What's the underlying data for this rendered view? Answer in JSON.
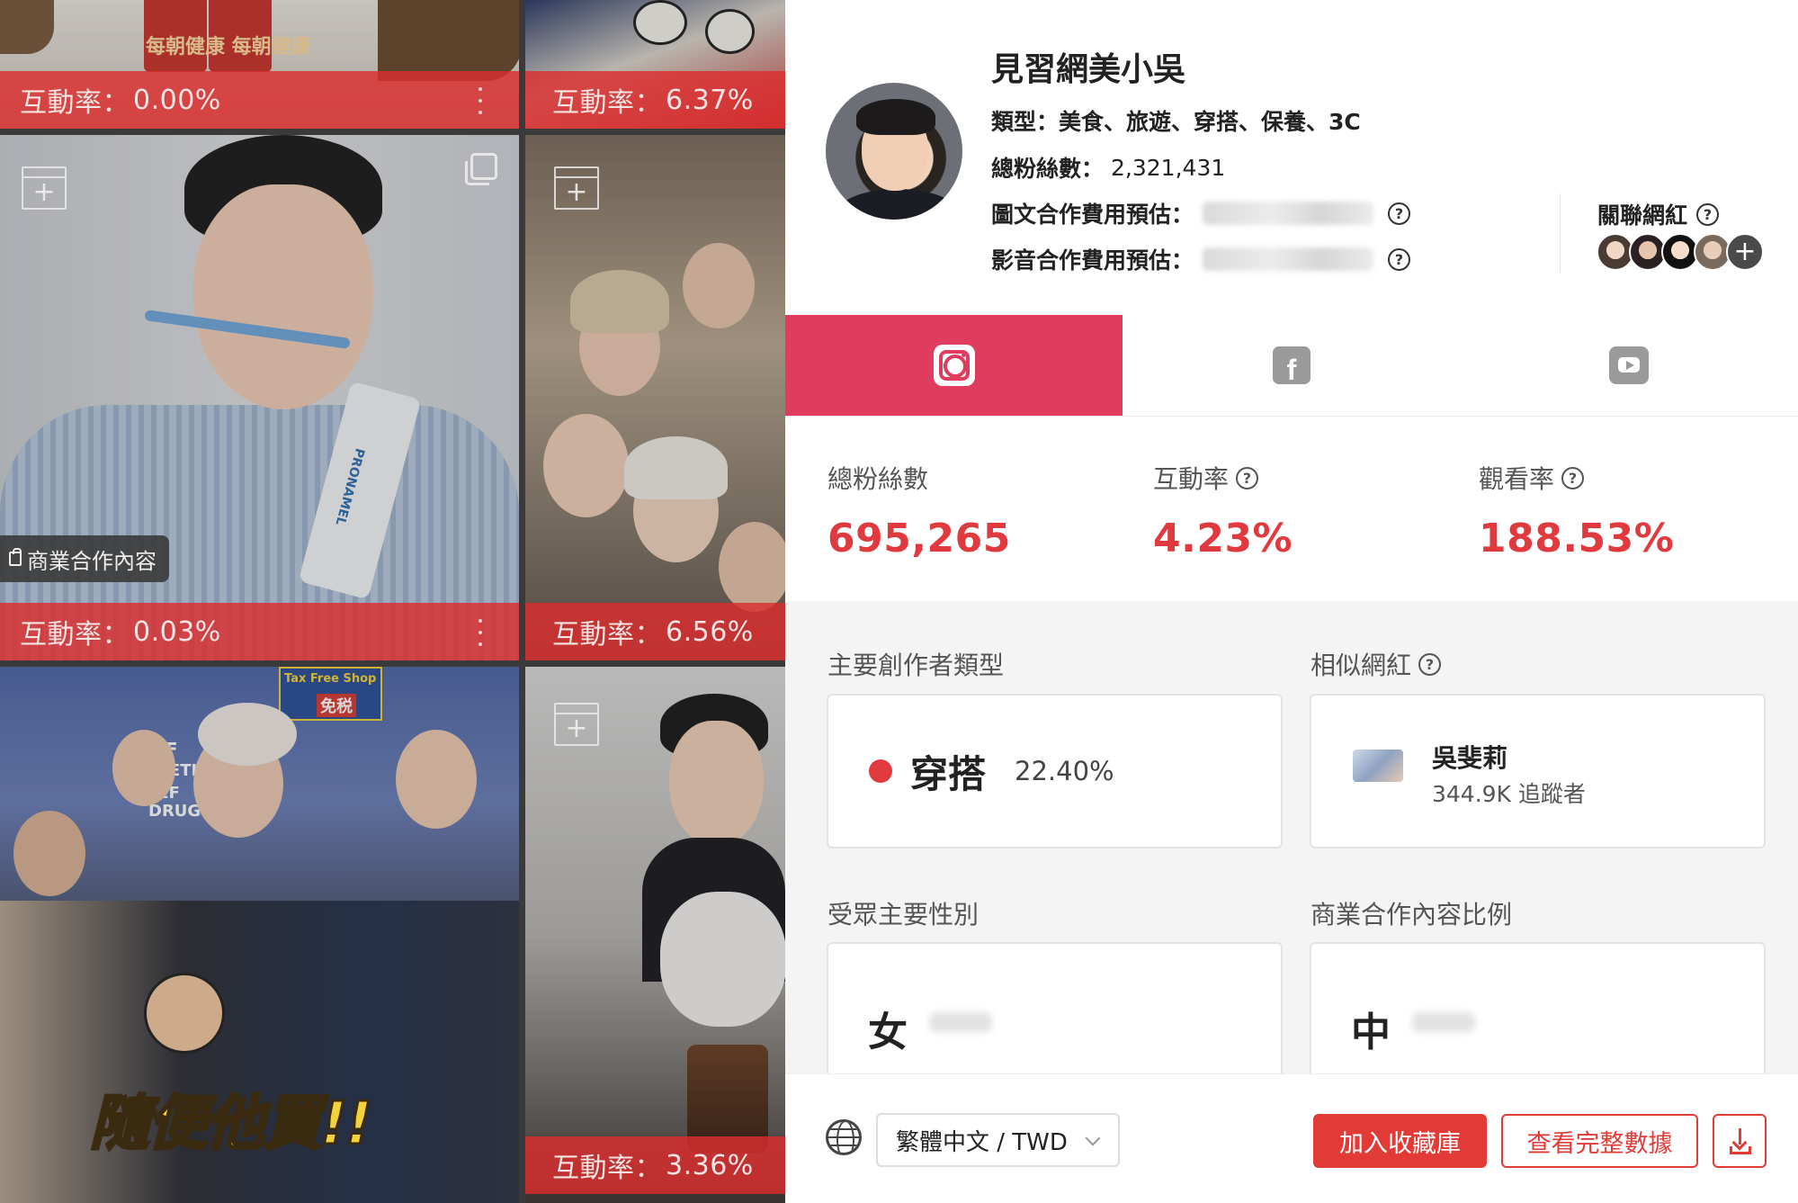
{
  "gallery": {
    "tiles": [
      {
        "rate_label": "互動率：",
        "rate_value": "0.00%"
      },
      {
        "rate_label": "互動率：",
        "rate_value": "6.37%"
      },
      {
        "rate_label": "互動率：",
        "rate_value": "0.03%"
      },
      {
        "rate_label": "互動率：",
        "rate_value": "6.56%"
      },
      {
        "rate_label": "互動率：",
        "rate_value": "3.36%"
      }
    ],
    "sponsor_badge": "商業合作內容",
    "photo_text": {
      "product_sign": "每朝健康 每朝健康",
      "toothpaste": "PRONAMEL",
      "shop_sign": "Tax Free Shop",
      "tax_free": "免税",
      "store_sign_1": "2F",
      "store_sign_2": "METIC",
      "store_sign_3": "1F",
      "store_sign_4": "DRUG",
      "caption": "隨便他買!!"
    }
  },
  "profile": {
    "name": "見習網美小吳",
    "category_label": "類型：",
    "category_value": "美食、旅遊、穿搭、保養、3C",
    "followers_label": "總粉絲數：",
    "followers_value": "2,321,431",
    "post_fee_label": "圖文合作費用預估：",
    "video_fee_label": "影音合作費用預估：",
    "related_label": "關聯網紅",
    "related_more": "+"
  },
  "tabs": [
    {
      "name": "instagram",
      "icon": "instagram-icon",
      "active": true
    },
    {
      "name": "facebook",
      "icon": "facebook-icon",
      "active": false
    },
    {
      "name": "youtube",
      "icon": "youtube-icon",
      "active": false
    }
  ],
  "stats": {
    "followers_label": "總粉絲數",
    "followers_value": "695,265",
    "engagement_label": "互動率",
    "engagement_value": "4.23%",
    "view_label": "觀看率",
    "view_value": "188.53%"
  },
  "creator_type": {
    "title": "主要創作者類型",
    "name": "穿搭",
    "percent": "22.40%"
  },
  "similar": {
    "title": "相似網紅",
    "name": "吳斐莉",
    "followers": "344.9K 追蹤者"
  },
  "gender": {
    "title": "受眾主要性別",
    "value": "女"
  },
  "sponsored_ratio": {
    "title": "商業合作內容比例",
    "value": "中"
  },
  "footer": {
    "language": "繁體中文 / TWD",
    "add_button": "加入收藏庫",
    "full_data_button": "查看完整數據"
  },
  "help_glyph": "?",
  "colors": {
    "accent": "#e03c5d",
    "red": "#e0393e",
    "button": "#e23a36"
  }
}
